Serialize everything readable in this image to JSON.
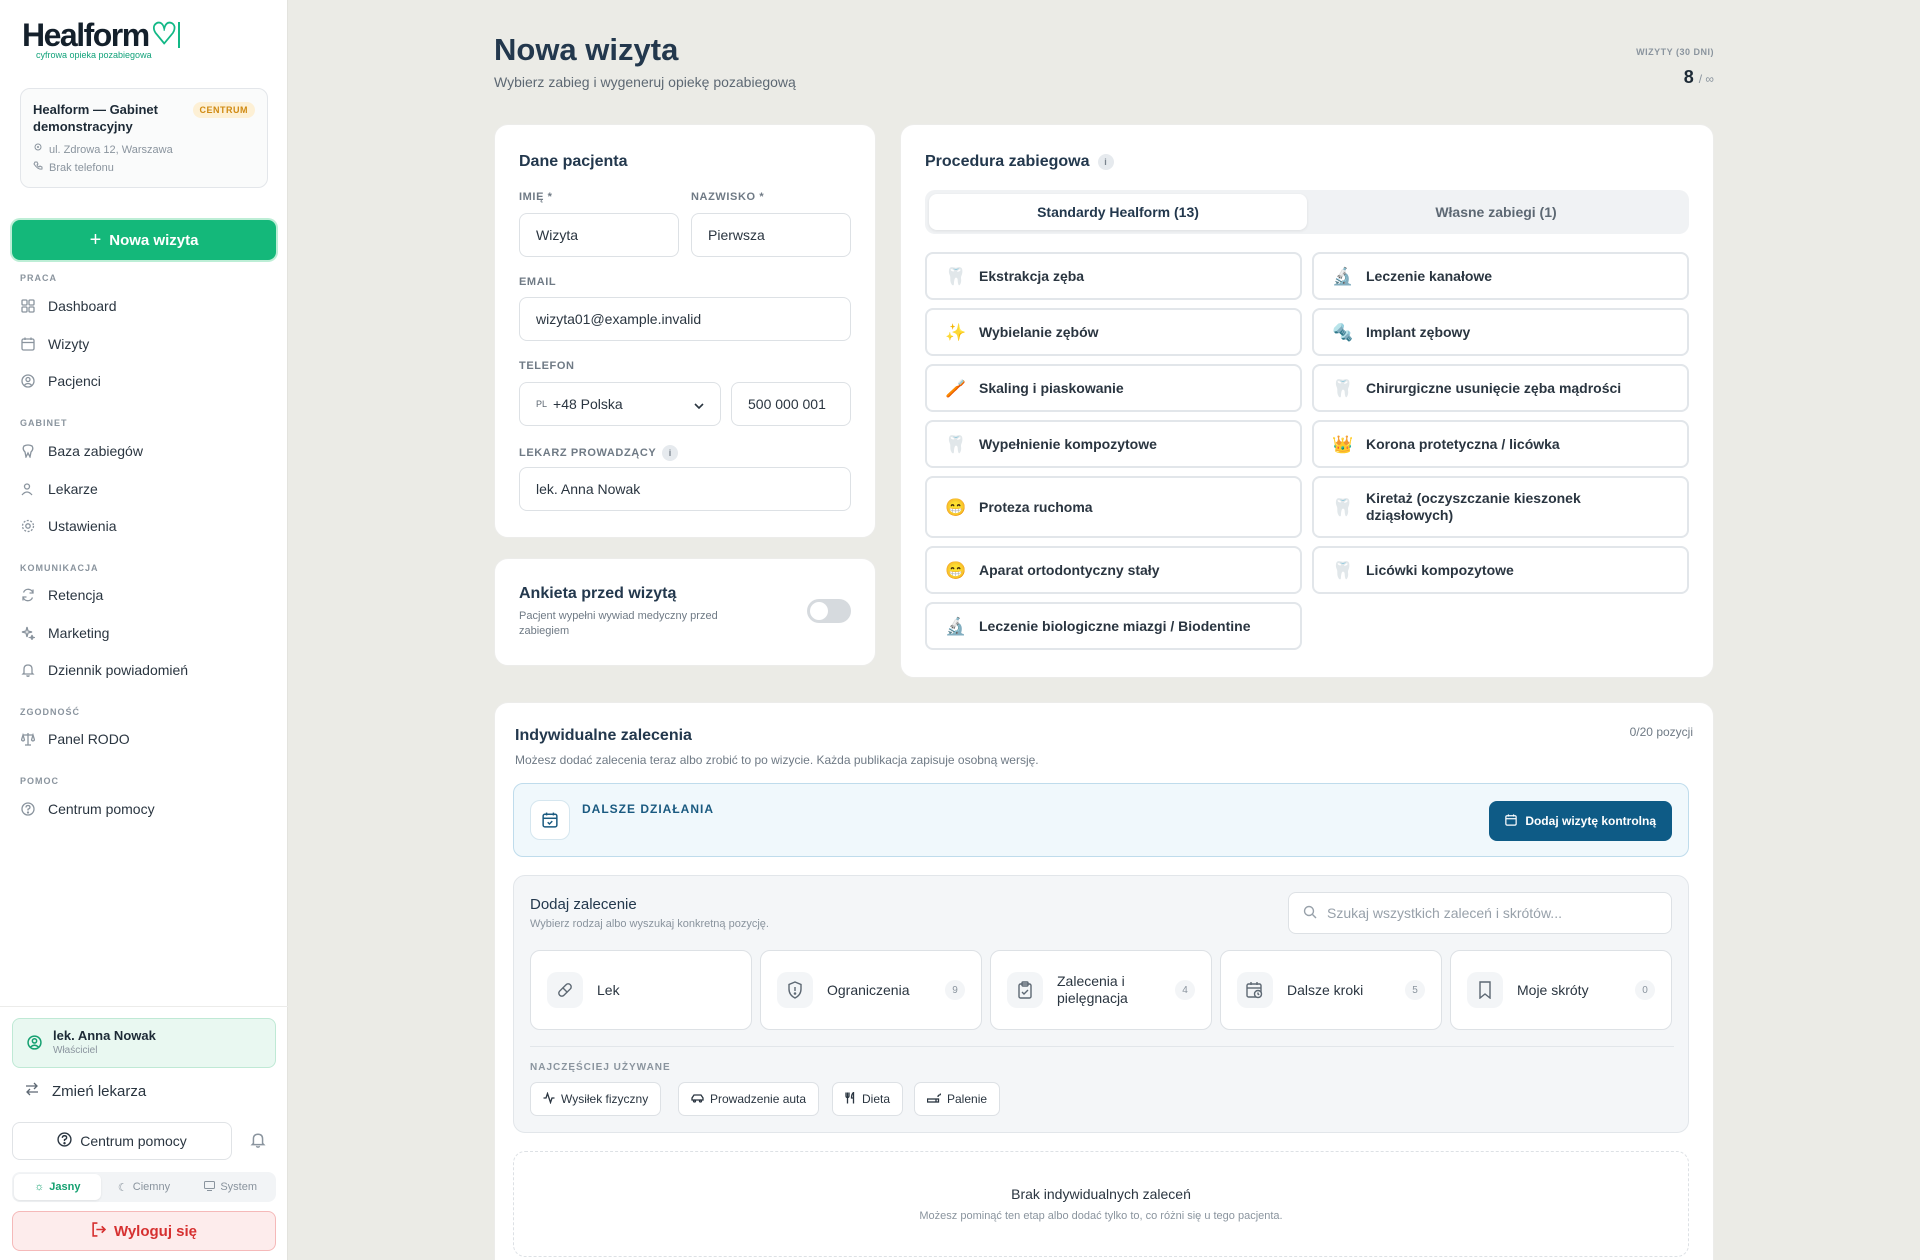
{
  "brand": {
    "name": "Healform",
    "tagline": "cyfrowa opieka pozabiegowa"
  },
  "clinic": {
    "name": "Healform — Gabinet demonstracyjny",
    "badge": "CENTRUM",
    "address": "ul. Zdrowa 12, Warszawa",
    "phone": "Brak telefonu"
  },
  "sidebar": {
    "new_visit": "Nowa wizyta",
    "sections": [
      {
        "label": "PRACA",
        "items": [
          "Dashboard",
          "Wizyty",
          "Pacjenci"
        ]
      },
      {
        "label": "GABINET",
        "items": [
          "Baza zabiegów",
          "Lekarze",
          "Ustawienia"
        ]
      },
      {
        "label": "KOMUNIKACJA",
        "items": [
          "Retencja",
          "Marketing",
          "Dziennik powiadomień"
        ]
      },
      {
        "label": "ZGODNOŚĆ",
        "items": [
          "Panel RODO"
        ]
      },
      {
        "label": "POMOC",
        "items": [
          "Centrum pomocy"
        ]
      }
    ],
    "user": {
      "name": "lek. Anna Nowak",
      "role": "Właściciel"
    },
    "switch_doctor": "Zmień lekarza",
    "help": "Centrum pomocy",
    "themes": [
      "Jasny",
      "Ciemny",
      "System"
    ],
    "logout": "Wyloguj się"
  },
  "header": {
    "title": "Nowa wizyta",
    "subtitle": "Wybierz zabieg i wygeneruj opiekę pozabiegową",
    "stat_label": "WIZYTY (30 DNI)",
    "stat_value": "8",
    "stat_limit": "/ ∞"
  },
  "patient": {
    "title": "Dane pacjenta",
    "first_name_label": "IMIĘ *",
    "first_name": "Wizyta",
    "last_name_label": "NAZWISKO *",
    "last_name": "Pierwsza",
    "email_label": "EMAIL",
    "email": "wizyta01@example.invalid",
    "phone_label": "TELEFON",
    "country_flag": "PL",
    "country": "+48 Polska",
    "phone": "500 000 001",
    "doctor_label": "LEKARZ PROWADZĄCY",
    "doctor": "lek. Anna Nowak"
  },
  "survey": {
    "title": "Ankieta przed wizytą",
    "desc": "Pacjent wypełni wywiad medyczny przed zabiegiem"
  },
  "procedure": {
    "title": "Procedura zabiegowa",
    "tabs": [
      "Standardy Healform (13)",
      "Własne zabiegi (1)"
    ],
    "items": [
      {
        "emoji": "🦷",
        "label": "Ekstrakcja zęba"
      },
      {
        "emoji": "🔬",
        "label": "Leczenie kanałowe"
      },
      {
        "emoji": "✨",
        "label": "Wybielanie zębów"
      },
      {
        "emoji": "🔩",
        "label": "Implant zębowy"
      },
      {
        "emoji": "🪥",
        "label": "Skaling i piaskowanie"
      },
      {
        "emoji": "🦷",
        "label": "Chirurgiczne usunięcie zęba mądrości"
      },
      {
        "emoji": "🦷",
        "label": "Wypełnienie kompozytowe"
      },
      {
        "emoji": "👑",
        "label": "Korona protetyczna / licówka"
      },
      {
        "emoji": "😁",
        "label": "Proteza ruchoma"
      },
      {
        "emoji": "🦷",
        "label": "Kiretaż (oczyszczanie kieszonek dziąsłowych)"
      },
      {
        "emoji": "😁",
        "label": "Aparat ortodontyczny stały"
      },
      {
        "emoji": "🦷",
        "label": "Licówki kompozytowe"
      },
      {
        "emoji": "🔬",
        "label": "Leczenie biologiczne miazgi / Biodentine"
      }
    ]
  },
  "recommendations": {
    "title": "Indywidualne zalecenia",
    "desc": "Możesz dodać zalecenia teraz albo zrobić to po wizycie. Każda publikacja zapisuje osobną wersję.",
    "count": "0/20 pozycji",
    "followup_label": "DALSZE DZIAŁANIA",
    "followup_button": "Dodaj wizytę kontrolną",
    "add_title": "Dodaj zalecenie",
    "add_desc": "Wybierz rodzaj albo wyszukaj konkretną pozycję.",
    "search_placeholder": "Szukaj wszystkich zaleceń i skrótów...",
    "categories": [
      {
        "label": "Lek",
        "count": ""
      },
      {
        "label": "Ograniczenia",
        "count": "9"
      },
      {
        "label": "Zalecenia i pielęgnacja",
        "count": "4"
      },
      {
        "label": "Dalsze kroki",
        "count": "5"
      },
      {
        "label": "Moje skróty",
        "count": "0"
      }
    ],
    "frequent_label": "NAJCZĘŚCIEJ UŻYWANE",
    "frequent": [
      "Wysiłek fizyczny",
      "Prowadzenie auta",
      "Dieta",
      "Palenie"
    ],
    "empty_title": "Brak indywidualnych zaleceń",
    "empty_desc": "Możesz pominąć ten etap albo dodać tylko to, co różni się u tego pacjenta."
  },
  "colors": {
    "accent": "#14b87a",
    "primary": "#0e5b86",
    "danger": "#d63030"
  }
}
